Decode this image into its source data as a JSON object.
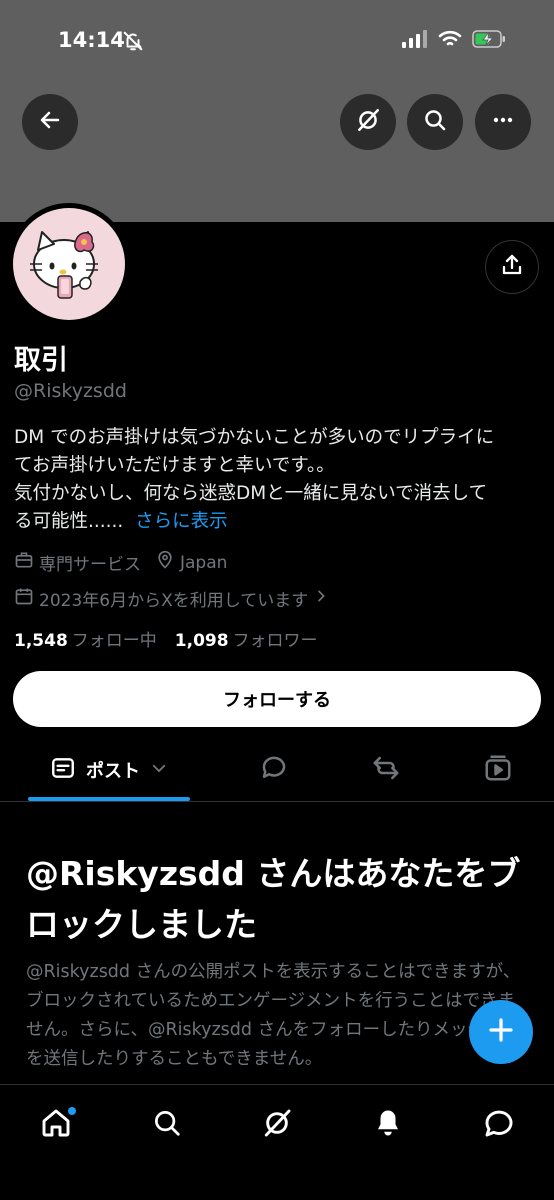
{
  "status_bar": {
    "time": "14:14"
  },
  "profile": {
    "name": "取引",
    "handle": "@Riskyzsdd",
    "bio_lines": [
      "DM でのお声掛けは気づかないことが多いのでリプライに",
      "てお声掛けいただけますと幸いです。。",
      "気付かないし、何なら迷惑DMと一緒に見ないで消去して",
      "る可能性......"
    ],
    "bio_more_label": "さらに表示",
    "category": "専門サービス",
    "location": "Japan",
    "joined": "2023年6月からXを利用しています",
    "following_count": "1,548",
    "following_label": "フォロー中",
    "followers_count": "1,098",
    "followers_label": "フォロワー"
  },
  "actions": {
    "follow_label": "フォローする"
  },
  "tabs": {
    "posts_label": "ポスト"
  },
  "blocked": {
    "title": "@Riskyzsdd さんはあなたをブロックしました",
    "description": "@Riskyzsdd さんの公開ポストを表示することはできますが、ブロックされているためエンゲージメントを行うことはできません。さらに、@Riskyzsdd さんをフォローしたりメッセージを送信したりすることもできません。"
  },
  "colors": {
    "accent": "#1d9bf0",
    "banner": "#5f5f5f",
    "muted": "#71767b"
  }
}
